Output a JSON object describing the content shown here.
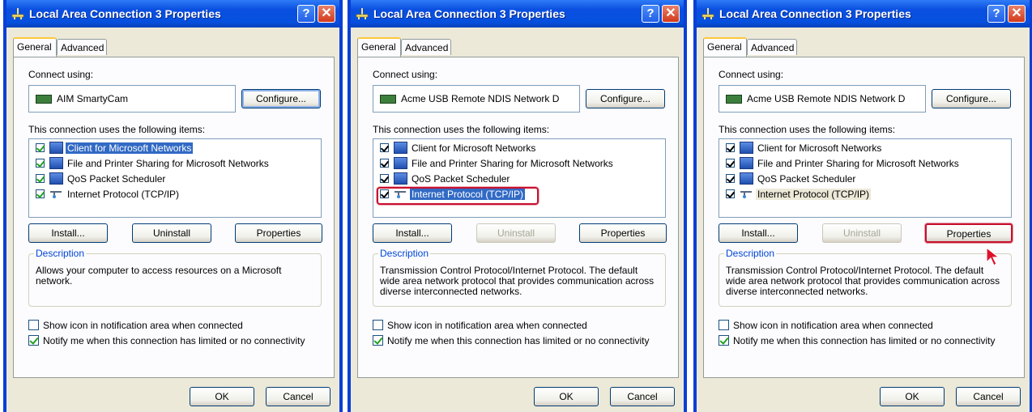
{
  "dialogs": [
    {
      "title": "Local Area Connection 3 Properties",
      "tabs": [
        "General",
        "Advanced"
      ],
      "connect_using_label": "Connect using:",
      "adapter_name": "AIM SmartyCam",
      "configure_label": "Configure...",
      "items_label": "This connection uses the following items:",
      "items": [
        {
          "label": "Client for Microsoft Networks",
          "checked": true
        },
        {
          "label": "File and Printer Sharing for Microsoft Networks",
          "checked": true
        },
        {
          "label": "QoS Packet Scheduler",
          "checked": true
        },
        {
          "label": "Internet Protocol (TCP/IP)",
          "checked": true
        }
      ],
      "install_label": "Install...",
      "uninstall_label": "Uninstall",
      "properties_label": "Properties",
      "description_legend": "Description",
      "description_text": "Allows your computer to access resources on a Microsoft network.",
      "show_icon_label": "Show icon in notification area when connected",
      "show_icon_checked": false,
      "notify_label": "Notify me when this connection has limited or no connectivity",
      "notify_checked": true,
      "ok_label": "OK",
      "cancel_label": "Cancel"
    },
    {
      "title": "Local Area Connection 3 Properties",
      "tabs": [
        "General",
        "Advanced"
      ],
      "connect_using_label": "Connect using:",
      "adapter_name": "Acme USB Remote NDIS Network D",
      "configure_label": "Configure...",
      "items_label": "This connection uses the following items:",
      "items": [
        {
          "label": "Client for Microsoft Networks",
          "checked": true
        },
        {
          "label": "File and Printer Sharing for Microsoft Networks",
          "checked": true
        },
        {
          "label": "QoS Packet Scheduler",
          "checked": true
        },
        {
          "label": "Internet Protocol (TCP/IP)",
          "checked": true
        }
      ],
      "install_label": "Install...",
      "uninstall_label": "Uninstall",
      "properties_label": "Properties",
      "description_legend": "Description",
      "description_text": "Transmission Control Protocol/Internet Protocol. The default wide area network protocol that provides communication across diverse interconnected networks.",
      "show_icon_label": "Show icon in notification area when connected",
      "show_icon_checked": false,
      "notify_label": "Notify me when this connection has limited or no connectivity",
      "notify_checked": true,
      "ok_label": "OK",
      "cancel_label": "Cancel"
    },
    {
      "title": "Local Area Connection 3 Properties",
      "tabs": [
        "General",
        "Advanced"
      ],
      "connect_using_label": "Connect using:",
      "adapter_name": "Acme USB Remote NDIS Network D",
      "configure_label": "Configure...",
      "items_label": "This connection uses the following items:",
      "items": [
        {
          "label": "Client for Microsoft Networks",
          "checked": true
        },
        {
          "label": "File and Printer Sharing for Microsoft Networks",
          "checked": true
        },
        {
          "label": "QoS Packet Scheduler",
          "checked": true
        },
        {
          "label": "Internet Protocol (TCP/IP)",
          "checked": true
        }
      ],
      "install_label": "Install...",
      "uninstall_label": "Uninstall",
      "properties_label": "Properties",
      "description_legend": "Description",
      "description_text": "Transmission Control Protocol/Internet Protocol. The default wide area network protocol that provides communication across diverse interconnected networks.",
      "show_icon_label": "Show icon in notification area when connected",
      "show_icon_checked": false,
      "notify_label": "Notify me when this connection has limited or no connectivity",
      "notify_checked": true,
      "ok_label": "OK",
      "cancel_label": "Cancel"
    }
  ],
  "colors": {
    "titlebar_blue": "#0A4FE0",
    "dialog_face": "#ECE9D8",
    "selection_blue": "#316AC5",
    "highlight_red": "#C8102E",
    "description_legend": "#0046D5"
  }
}
